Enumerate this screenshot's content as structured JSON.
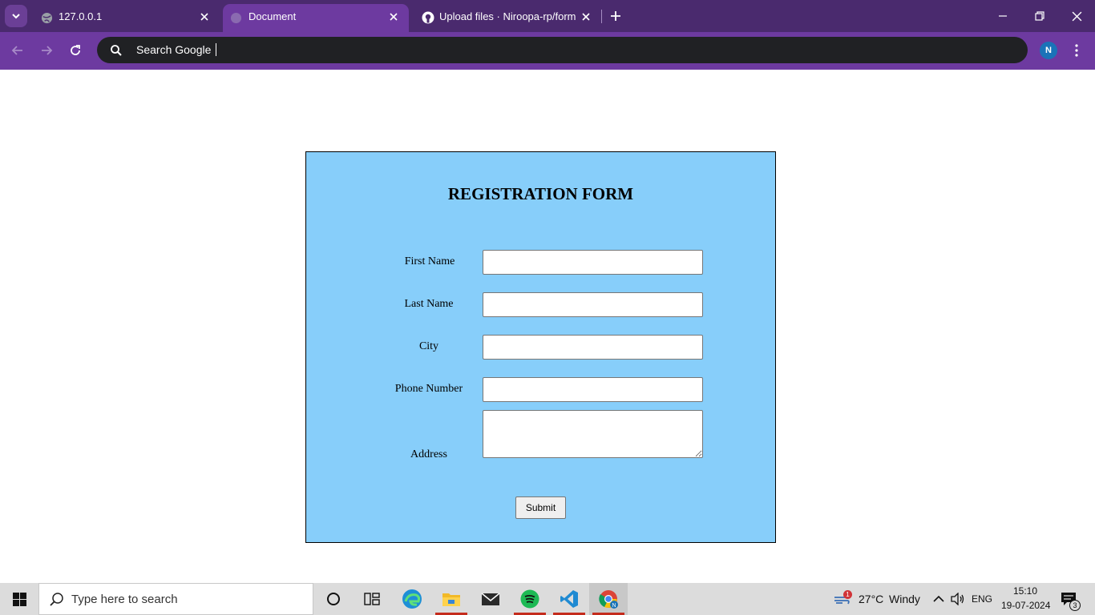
{
  "browser": {
    "tabs": [
      {
        "title": "127.0.0.1",
        "active": false
      },
      {
        "title": "Document",
        "active": true
      },
      {
        "title": "Upload files · Niroopa-rp/form",
        "active": false
      }
    ],
    "omnibox": {
      "text": "Search Google"
    },
    "profile_initial": "N",
    "colors": {
      "frame": "#4a2a6e",
      "toolbar": "#6d3aa0",
      "omnibox": "#202124"
    }
  },
  "form": {
    "title": "REGISTRATION FORM",
    "fields": {
      "first_name": {
        "label": "First Name",
        "value": ""
      },
      "last_name": {
        "label": "Last Name",
        "value": ""
      },
      "city": {
        "label": "City",
        "value": ""
      },
      "phone": {
        "label": "Phone Number",
        "value": ""
      },
      "address": {
        "label": "Address",
        "value": ""
      }
    },
    "submit_label": "Submit",
    "background_color": "#87cefa"
  },
  "taskbar": {
    "search_placeholder": "Type here to search",
    "pinned_apps": [
      "cortana-icon",
      "task-view-icon",
      "edge-icon",
      "file-explorer-icon",
      "mail-icon",
      "spotify-icon",
      "vscode-icon",
      "chrome-icon"
    ],
    "weather": {
      "temperature": "27°C",
      "condition": "Windy",
      "badge": "1"
    },
    "language": "ENG",
    "time": "15:10",
    "date": "19-07-2024",
    "notification_count": "3"
  }
}
